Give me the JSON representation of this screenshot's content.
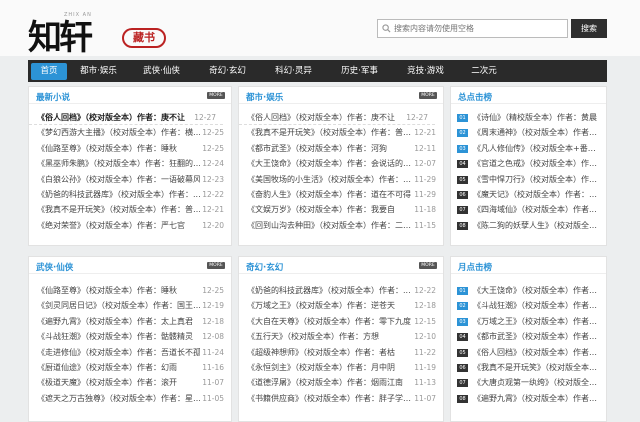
{
  "header": {
    "logo_text": "知轩",
    "logo_small": "ZHIX AN",
    "logo_seal": "藏书",
    "search_placeholder": "搜索内容请勿使用空格",
    "search_button": "搜索"
  },
  "nav": [
    "首页",
    "都市·娱乐",
    "武侠·仙侠",
    "奇幻·玄幻",
    "科幻·灵异",
    "历史·军事",
    "竞技·游戏",
    "二次元"
  ],
  "panels": {
    "latest": {
      "title": "最新小说",
      "more": "MORE",
      "rows": [
        {
          "t": "《俗人回档》（校对版全本）作者：庚不让",
          "d": "12-27"
        },
        {
          "t": "《梦幻西游大主播》（校对版全本）作者：横比...",
          "d": "12-25"
        },
        {
          "t": "《仙路至尊》（校对版全本）作者：睡秋",
          "d": "12-25"
        },
        {
          "t": "《黑巫师朱鹏》（校对版全本）作者：狂翻的威...",
          "d": "12-24"
        },
        {
          "t": "《白狼公孙》（校对版全本）作者：一语破幕风",
          "d": "12-23"
        },
        {
          "t": "《奶爸的科技武器库》（校对版全本）作者：...",
          "d": "12-22"
        },
        {
          "t": "《我真不是开玩笑》（校对版全本）作者：普经...",
          "d": "12-21"
        },
        {
          "t": "《绝对荣誉》（校对版全本）作者：严七官",
          "d": "12-20"
        }
      ]
    },
    "dushi": {
      "title": "都市·娱乐",
      "more": "MORE",
      "rows": [
        {
          "t": "《俗人回档》（校对版全本）作者：庚不让",
          "d": "12-27"
        },
        {
          "t": "《我真不是开玩笑》（校对版全本）作者：普经...",
          "d": "12-21"
        },
        {
          "t": "《都市武圣》（校对版全本）作者：河狗",
          "d": "12-11"
        },
        {
          "t": "《大王饶命》（校对版全本）作者：会说话的肘...",
          "d": "12-07"
        },
        {
          "t": "《美国牧场的小生活》（校对版全本）作者：鞋...",
          "d": "11-29"
        },
        {
          "t": "《奋豹人生》（校对版全本）作者：道在不可得",
          "d": "11-29"
        },
        {
          "t": "《文娱万岁》（校对版全本）作者：我要自",
          "d": "11-18"
        },
        {
          "t": "《回到山沟去种田》（校对版全本）作者：二子...",
          "d": "11-15"
        }
      ]
    },
    "hot": {
      "title": "总点击榜",
      "rows": [
        {
          "b": "01",
          "t": "《诗仙》（精校版全本）作者：黄晨"
        },
        {
          "b": "02",
          "t": "《周末通神》（校对版全本）作者：..."
        },
        {
          "b": "03",
          "t": "《凡人修仙传》（校对版全本+番外..."
        },
        {
          "b": "04",
          "t": "《官道之色戒》（校对版全本）作者..."
        },
        {
          "b": "05",
          "t": "《雪中悍刀行》（校对版全本）作者..."
        },
        {
          "b": "06",
          "t": "《魔天记》（校对版全本）作者：忘..."
        },
        {
          "b": "07",
          "t": "《四海域仙》（校对版全本）作者..."
        },
        {
          "b": "08",
          "t": "《陈二狗的妖孽人生》（校对版全本..."
        }
      ]
    },
    "wuxia": {
      "title": "武侠·仙侠",
      "more": "MORE",
      "rows": [
        {
          "t": "《仙路至尊》（校对版全本）作者：睡秋",
          "d": "12-25"
        },
        {
          "t": "《剑灵同居日记》（校对版全本）作者：国王陛...",
          "d": "12-19"
        },
        {
          "t": "《遍野九霄》（校对版全本）作者：太上真君",
          "d": "12-18"
        },
        {
          "t": "《斗战狂潮》（校对版全本）作者：骷髅精灵",
          "d": "12-08"
        },
        {
          "t": "《走进修仙》（校对版全本）作者：吾道长不孤",
          "d": "11-24"
        },
        {
          "t": "《厨道仙途》（校对版全本）作者：幻雨",
          "d": "11-16"
        },
        {
          "t": "《极道天魔》（校对版全本）作者：滚开",
          "d": "11-07"
        },
        {
          "t": "《遮天之万古独尊》（校对版全本）作者：星之...",
          "d": "11-05"
        }
      ]
    },
    "qihuan": {
      "title": "奇幻·玄幻",
      "more": "MORE",
      "rows": [
        {
          "t": "《奶爸的科技武器库》（校对版全本）作者：...",
          "d": "12-22"
        },
        {
          "t": "《万域之王》（校对版全本）作者：逆苍天",
          "d": "12-18"
        },
        {
          "t": "《大自在天尊》（校对版全本）作者：零下九度",
          "d": "12-15"
        },
        {
          "t": "《五行天》（校对版全本）作者：方想",
          "d": "12-10"
        },
        {
          "t": "《超级神想师》（校对版全本）作者：者枯",
          "d": "11-22"
        },
        {
          "t": "《永恒剑主》（校对版全本）作者：月中阴",
          "d": "11-19"
        },
        {
          "t": "《道德浮屠》（校对版全本）作者：烟雨江南",
          "d": "11-13"
        },
        {
          "t": "《书籍供应商》（校对版全本）作者：胖子学的...",
          "d": "11-07"
        }
      ]
    },
    "monthly": {
      "title": "月点击榜",
      "rows": [
        {
          "b": "01",
          "t": "《大王饶命》（校对版全本）作者：..."
        },
        {
          "b": "02",
          "t": "《斗战狂潮》（校对版全本）作者：..."
        },
        {
          "b": "03",
          "t": "《万域之王》（校对版全本）作者：..."
        },
        {
          "b": "04",
          "t": "《都市武圣》（校对版全本）作者：..."
        },
        {
          "b": "05",
          "t": "《俗人回档》（校对版全本）作者：..."
        },
        {
          "b": "06",
          "t": "《我真不是开玩笑》（校对版全本）..."
        },
        {
          "b": "07",
          "t": "《大唐贞观第一纨绔》（校对版全本..."
        },
        {
          "b": "08",
          "t": "《遍野九霄》（校对版全本）作者：..."
        }
      ]
    }
  },
  "colors": {
    "accent": "#2c93d6",
    "nav_bg": "#2a2a2a",
    "badge_dark": "#333333"
  }
}
